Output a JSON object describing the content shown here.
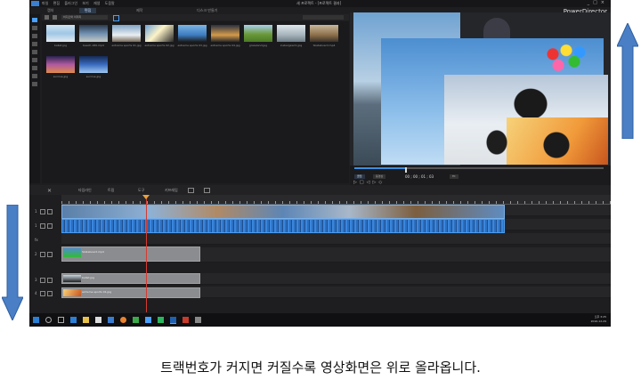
{
  "app": {
    "title": "새 프로젝트 - [프로젝트 결과]",
    "brand": "PowerDirector",
    "menu": [
      "파일",
      "편집",
      "플러그인",
      "보기",
      "재생",
      "도움말"
    ],
    "window_controls": [
      "_",
      "□",
      "×"
    ],
    "tabs": [
      {
        "label": "캡처",
        "active": false
      },
      {
        "label": "편집",
        "active": true
      },
      {
        "label": "제작",
        "active": false
      },
      {
        "label": "디스크 만들기",
        "active": false
      }
    ],
    "library_filter": "비디오와 이미지",
    "library_items": [
      {
        "label": "ballet.jpg"
      },
      {
        "label": "beach-180.mp4"
      },
      {
        "label": "extreme sports 01.jpg"
      },
      {
        "label": "extreme sports 02.jpg"
      },
      {
        "label": "extreme sports 03.jpg"
      },
      {
        "label": "extreme sports 04.jpg"
      },
      {
        "label": "grassland.jpg"
      },
      {
        "label": "icebergswim.jpg"
      },
      {
        "label": "Skateboard.mp4"
      },
      {
        "label": "sunrise.jpg"
      },
      {
        "label": "sunrise.jpg"
      }
    ],
    "preview_controls": {
      "clip_button": "클립",
      "movie_button": "동영상",
      "timecode": "00 ; 00 ; 01 ; 03",
      "zoom": "Fit"
    },
    "timeline_toolbar": [
      "타임라인",
      "트림",
      "도구",
      "키프레임"
    ],
    "tracks": [
      {
        "number": "1"
      },
      {
        "number": "1"
      },
      {
        "number": "fx"
      },
      {
        "number": "2"
      },
      {
        "number": "3"
      },
      {
        "number": "4"
      }
    ],
    "clips": {
      "video_track2": "Skateboard.mp4",
      "video_track3": "ballet.jpg",
      "video_track4": "extreme sports 01.jpg"
    },
    "tray": {
      "time": "오후 3:25",
      "date": "2016-12-29"
    }
  },
  "caption": "트랙번호가 커지면 커질수록 영상화면은 위로 올라옵니다.",
  "colors": {
    "arrow": "#4a7fc6",
    "accent": "#3a8fe0",
    "playhead": "#d43b30"
  }
}
